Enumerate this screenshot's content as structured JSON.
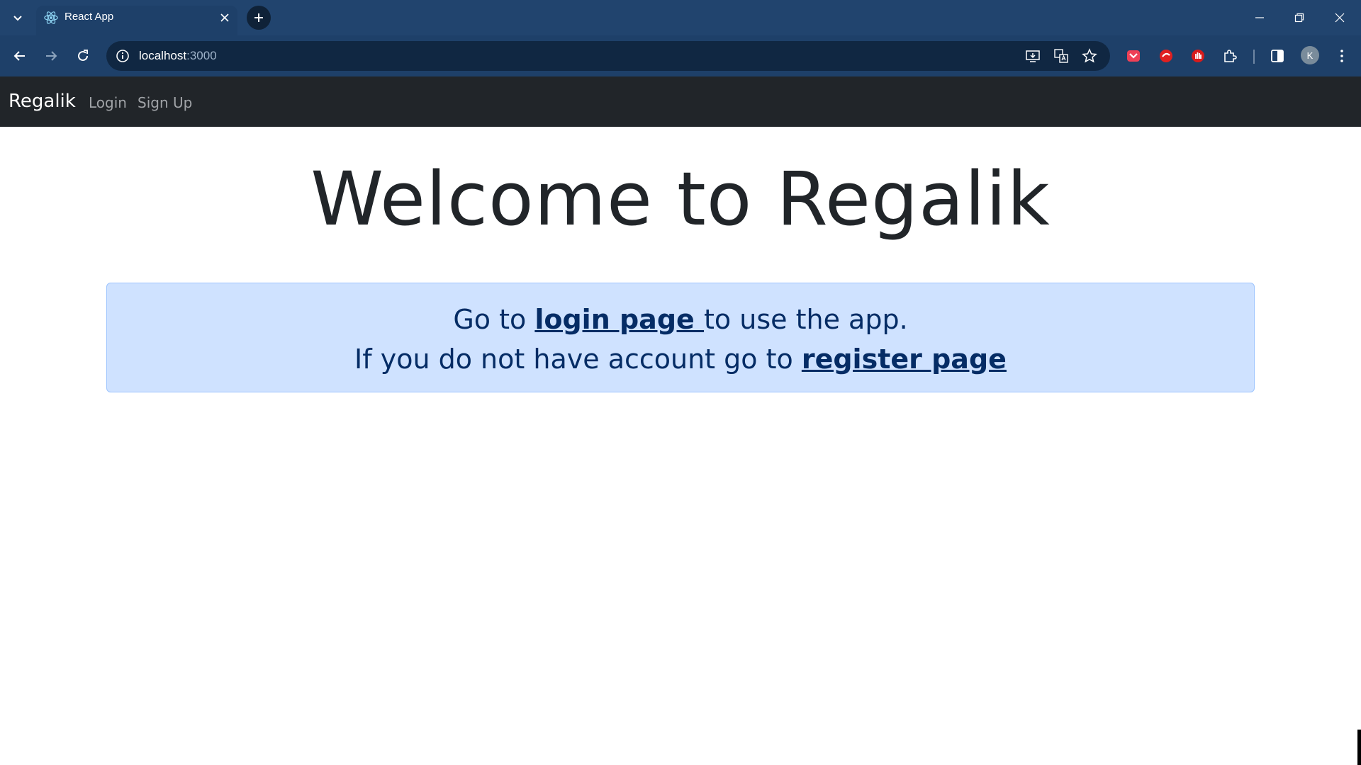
{
  "browser": {
    "tab": {
      "title": "React App"
    },
    "omnibox": {
      "host": "localhost",
      "port": ":3000"
    },
    "profile_initial": "K",
    "colors": {
      "frame": "#21446e",
      "toolbar": "#1e4069",
      "omnibox": "#102742"
    }
  },
  "app": {
    "navbar": {
      "brand": "Regalik",
      "links": [
        {
          "label": "Login"
        },
        {
          "label": "Sign Up"
        }
      ]
    },
    "headline": "Welcome to Regalik",
    "alert": {
      "line1_prefix": "Go to ",
      "login_link": "login page ",
      "line1_suffix": "to use the app.",
      "line2_prefix": "If you do not have account go to ",
      "register_link": "register page"
    },
    "colors": {
      "navbar": "#212529",
      "alert_bg": "#cfe2ff",
      "alert_text": "#052c65"
    }
  }
}
